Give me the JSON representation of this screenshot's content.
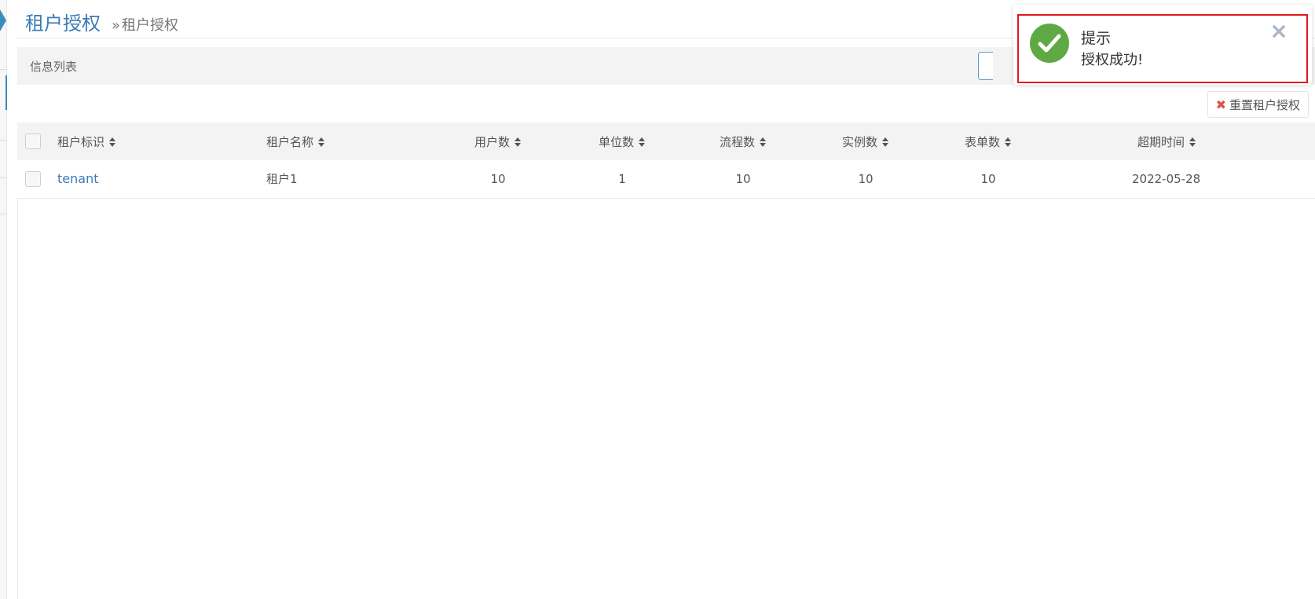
{
  "breadcrumb": {
    "title": "租户授权",
    "separator": "»",
    "current": "租户授权"
  },
  "panel": {
    "title": "信息列表"
  },
  "toolbar": {
    "reset_label": "重置租户授权"
  },
  "table": {
    "columns": [
      "租户标识",
      "租户名称",
      "用户数",
      "单位数",
      "流程数",
      "实例数",
      "表单数",
      "超期时间"
    ],
    "rows": [
      {
        "tenant_id": "tenant",
        "tenant_name": "租户1",
        "users": "10",
        "units": "1",
        "flows": "10",
        "instances": "10",
        "forms": "10",
        "expire": "2022-05-28"
      }
    ]
  },
  "toast": {
    "title": "提示",
    "message": "授权成功!"
  },
  "colors": {
    "accent": "#3c7bb6",
    "success": "#5fa945",
    "highlight": "#e0191f",
    "danger": "#d9534f"
  }
}
